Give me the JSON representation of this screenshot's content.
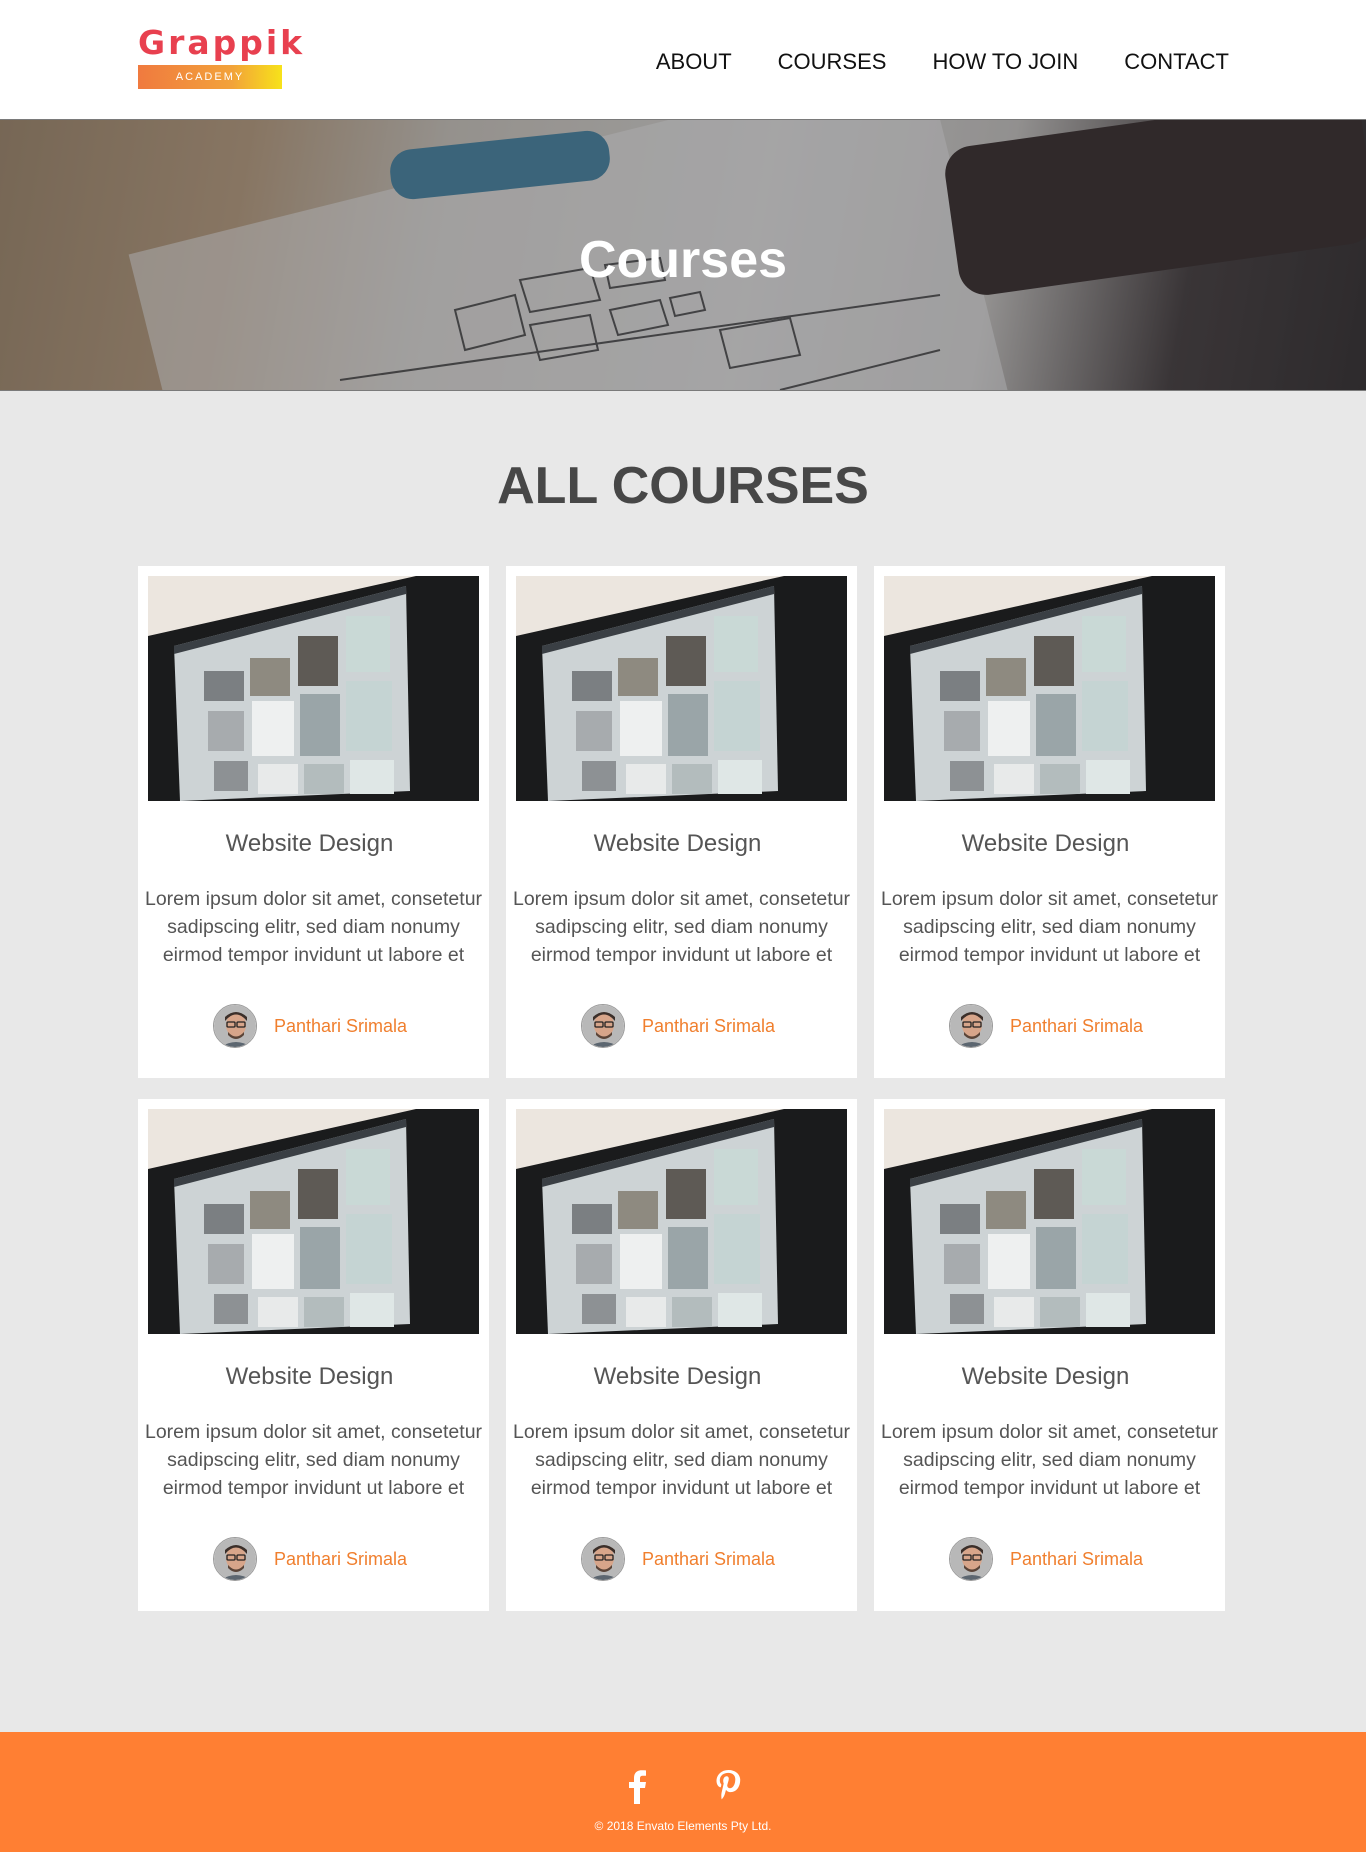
{
  "header": {
    "logo_word": "Grappik",
    "logo_tagline": "ACADEMY",
    "nav": [
      "ABOUT",
      "COURSES",
      "HOW TO JOIN",
      "CONTACT"
    ]
  },
  "hero": {
    "title": "Courses"
  },
  "main": {
    "section_title": "ALL COURSES",
    "courses": [
      {
        "title": "Website Design",
        "line1": "Lorem ipsum dolor sit amet, consetetur",
        "line2": "sadipscing elitr, sed diam nonumy",
        "line3": "eirmod tempor invidunt ut labore et",
        "author": "Panthari Srimala"
      },
      {
        "title": "Website Design",
        "line1": "Lorem ipsum dolor sit amet, consetetur",
        "line2": "sadipscing elitr, sed diam nonumy",
        "line3": "eirmod tempor invidunt ut labore et",
        "author": "Panthari Srimala"
      },
      {
        "title": "Website Design",
        "line1": "Lorem ipsum dolor sit amet, consetetur",
        "line2": "sadipscing elitr, sed diam nonumy",
        "line3": "eirmod tempor invidunt ut labore et",
        "author": "Panthari Srimala"
      },
      {
        "title": "Website Design",
        "line1": "Lorem ipsum dolor sit amet, consetetur",
        "line2": "sadipscing elitr, sed diam nonumy",
        "line3": "eirmod tempor invidunt ut labore et",
        "author": "Panthari Srimala"
      },
      {
        "title": "Website Design",
        "line1": "Lorem ipsum dolor sit amet, consetetur",
        "line2": "sadipscing elitr, sed diam nonumy",
        "line3": "eirmod tempor invidunt ut labore et",
        "author": "Panthari Srimala"
      },
      {
        "title": "Website Design",
        "line1": "Lorem ipsum dolor sit amet, consetetur",
        "line2": "sadipscing elitr, sed diam nonumy",
        "line3": "eirmod tempor invidunt ut labore et",
        "author": "Panthari Srimala"
      }
    ]
  },
  "footer": {
    "social": [
      "facebook-icon",
      "pinterest-icon"
    ],
    "copyright": "© 2018 Envato Elements Pty Ltd."
  },
  "colors": {
    "logo": "#e8404f",
    "accent": "#ff7f33",
    "author_link": "#f07f2e",
    "page_bg": "#e8e8e8"
  }
}
